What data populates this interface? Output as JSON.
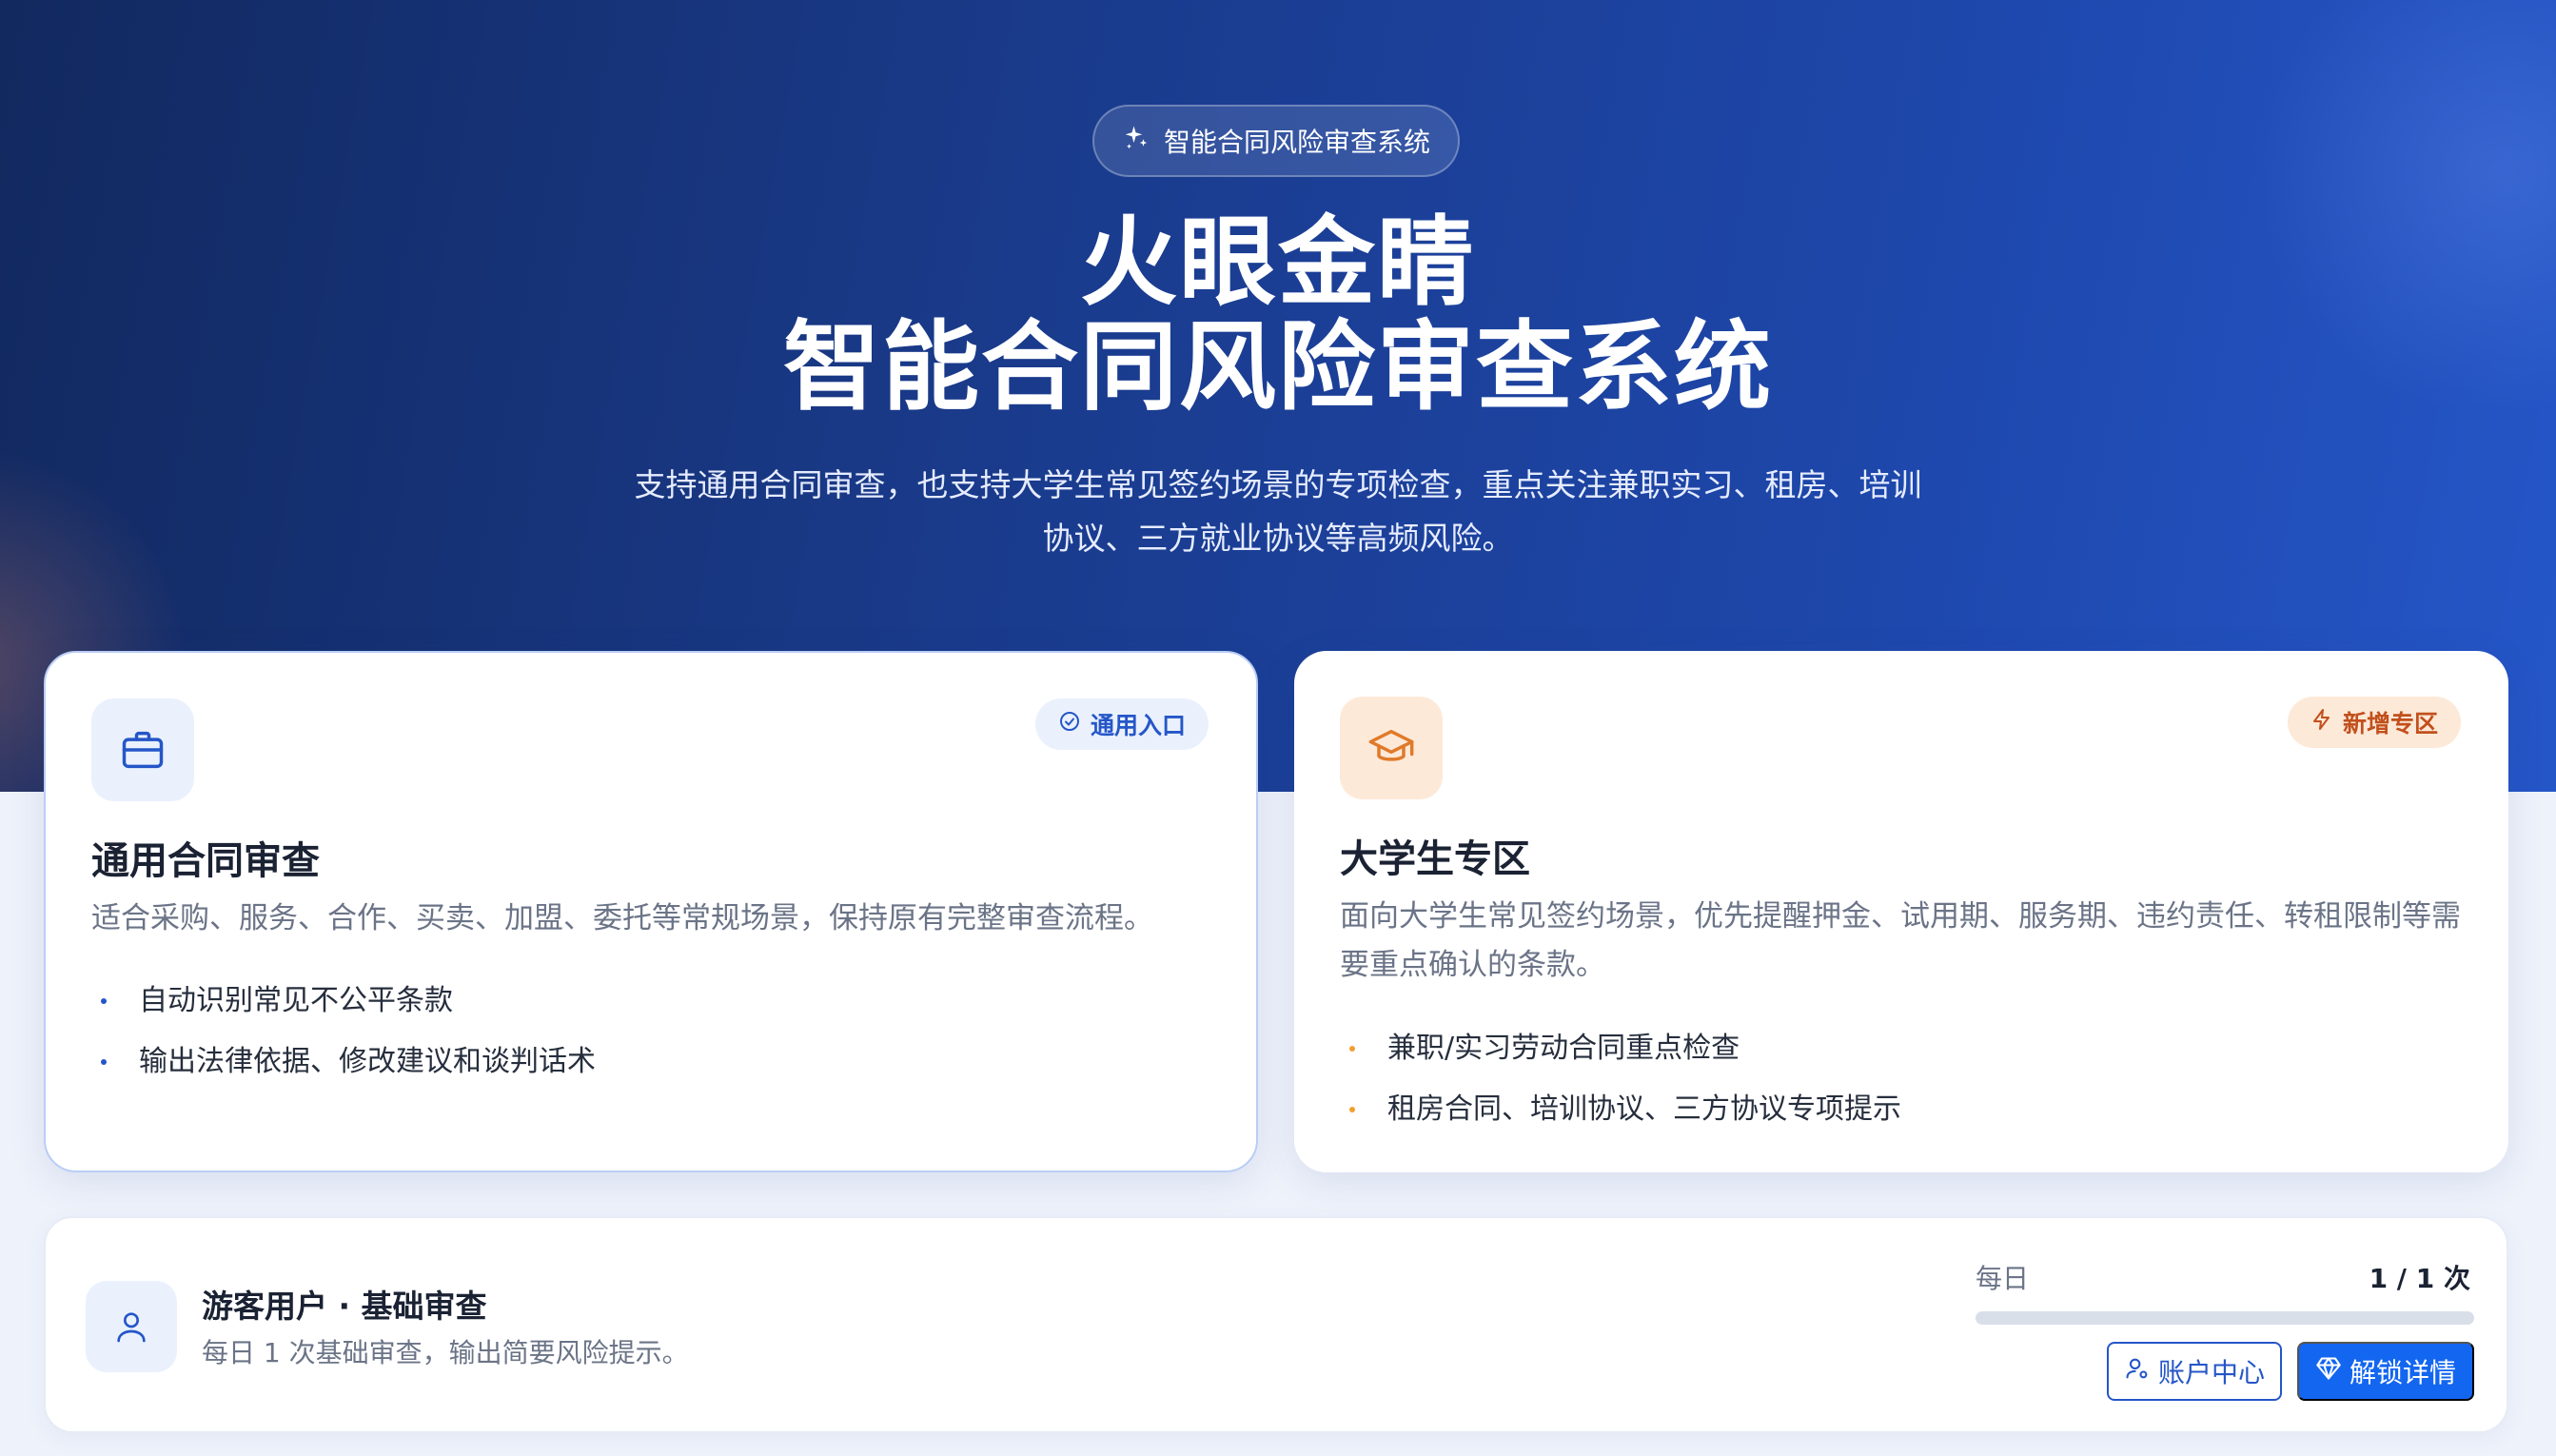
{
  "hero": {
    "badge": "智能合同风险审查系统",
    "title_line1": "火眼金睛",
    "title_line2": "智能合同风险审查系统",
    "subtitle_line1": "支持通用合同审查，也支持大学生常见签约场景的专项检查，重点关注兼职实习、租房、培训",
    "subtitle_line2": "协议、三方就业协议等高频风险。"
  },
  "cards": {
    "general": {
      "icon": "briefcase-icon",
      "badge": "通用入口",
      "badge_icon": "check-circle-icon",
      "title": "通用合同审查",
      "desc": "适合采购、服务、合作、买卖、加盟、委托等常规场景，保持原有完整审查流程。",
      "items": [
        "自动识别常见不公平条款",
        "输出法律依据、修改建议和谈判话术"
      ]
    },
    "student": {
      "icon": "graduation-cap-icon",
      "badge": "新增专区",
      "badge_icon": "lightning-icon",
      "title": "大学生专区",
      "desc": "面向大学生常见签约场景，优先提醒押金、试用期、服务期、违约责任、转租限制等需要重点确认的条款。",
      "items": [
        "兼职/实习劳动合同重点检查",
        "租房合同、培训协议、三方协议专项提示"
      ]
    }
  },
  "user": {
    "icon": "user-icon",
    "name": "游客用户 · 基础审查",
    "desc": "每日 1 次基础审查，输出简要风险提示。",
    "quota_label": "每日",
    "quota_value": "1 / 1 次",
    "quota_used_fraction": 1.0,
    "account_button": "账户中心",
    "unlock_button": "解锁详情"
  },
  "colors": {
    "primary": "#2556c8",
    "button_blue": "#1366f0",
    "orange_accent": "#c2501c"
  }
}
